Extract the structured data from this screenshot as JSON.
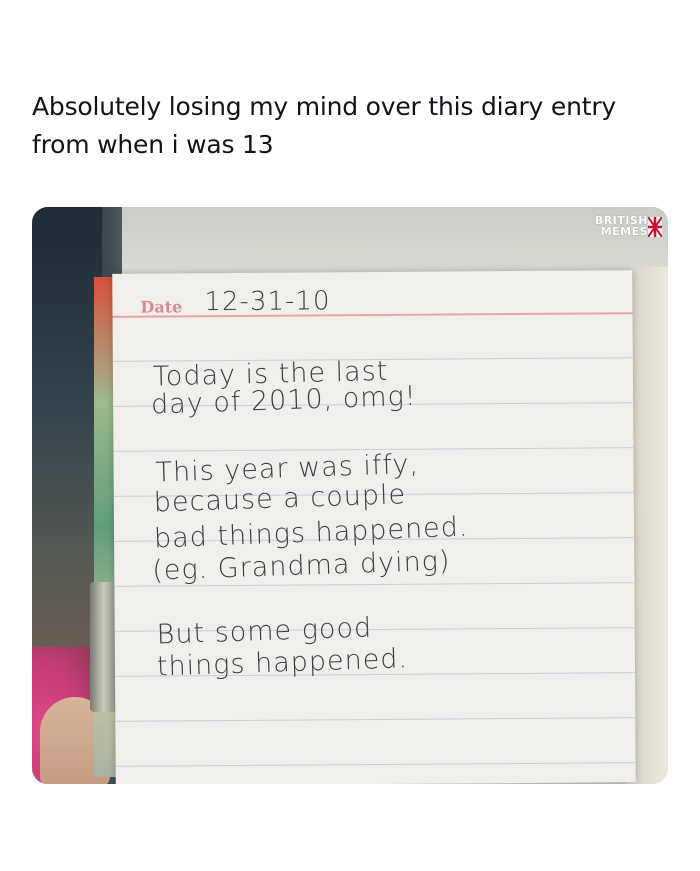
{
  "post": {
    "caption_line1": "Absolutely losing my mind over this diary entry",
    "caption_line2": "from when i was 13"
  },
  "diary": {
    "date_label": "Date",
    "date_value": "12-31-10",
    "lines": [
      "Today is the last",
      "day of 2010, omg!",
      "This year was iffy,",
      "because a couple",
      "bad things happened.",
      "(eg. Grandma dying)",
      "But some good",
      "things happened."
    ]
  },
  "watermark": {
    "line1": "BRITISH",
    "line2": "MEMES"
  }
}
